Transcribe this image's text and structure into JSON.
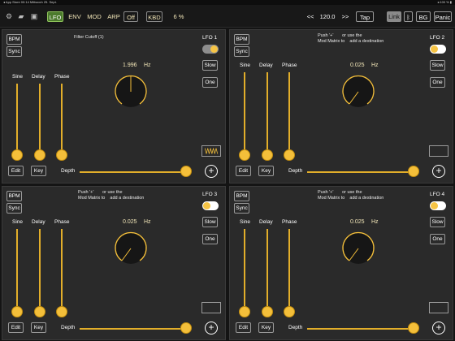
{
  "status": {
    "left": "◂ App Store  00:14  Mittwoch 25. Sept.",
    "right": "◂ 100 % ▮"
  },
  "toolbar": {
    "tabs": [
      "LFO",
      "ENV",
      "MOD",
      "ARP"
    ],
    "off_label": "Off",
    "kbd_label": "KBD",
    "percent": "6 %",
    "tempo_prev": "<<",
    "tempo": "120.0",
    "tempo_next": ">>",
    "tap": "Tap",
    "link": "Link",
    "bluetooth": "ᛒ",
    "bg": "BG",
    "panic": "Panic"
  },
  "panels": [
    {
      "title": "LFO 1",
      "hint": "Filter Cutoff (1)",
      "rate": "1.996",
      "unit": "Hz",
      "bpm": "BPM",
      "sync": "Sync",
      "sine": "Sine",
      "delay": "Delay",
      "phase": "Phase",
      "slow": "Slow",
      "one": "One",
      "edit": "Edit",
      "key": "Key",
      "depth": "Depth",
      "toggle_on": true
    },
    {
      "title": "LFO 2",
      "hint": "Push '+'       or use the\nMod Matrix to    add a destination",
      "rate": "0.025",
      "unit": "Hz",
      "bpm": "BPM",
      "sync": "Sync",
      "sine": "Sine",
      "delay": "Delay",
      "phase": "Phase",
      "slow": "Slow",
      "one": "One",
      "edit": "Edit",
      "key": "Key",
      "depth": "Depth",
      "toggle_on": false
    },
    {
      "title": "LFO 3",
      "hint": "Push '+'       or use the\nMod Matrix to    add a destination",
      "rate": "0.025",
      "unit": "Hz",
      "bpm": "BPM",
      "sync": "Sync",
      "sine": "Sine",
      "delay": "Delay",
      "phase": "Phase",
      "slow": "Slow",
      "one": "One",
      "edit": "Edit",
      "key": "Key",
      "depth": "Depth",
      "toggle_on": false
    },
    {
      "title": "LFO 4",
      "hint": "Push '+'       or use the\nMod Matrix to    add a destination",
      "rate": "0.025",
      "unit": "Hz",
      "bpm": "BPM",
      "sync": "Sync",
      "sine": "Sine",
      "delay": "Delay",
      "phase": "Phase",
      "slow": "Slow",
      "one": "One",
      "edit": "Edit",
      "key": "Key",
      "depth": "Depth",
      "toggle_on": false
    }
  ],
  "colors": {
    "accent": "#f4bf3a",
    "panel": "#2a2a2a",
    "active_tab": "#4b7a2d"
  }
}
